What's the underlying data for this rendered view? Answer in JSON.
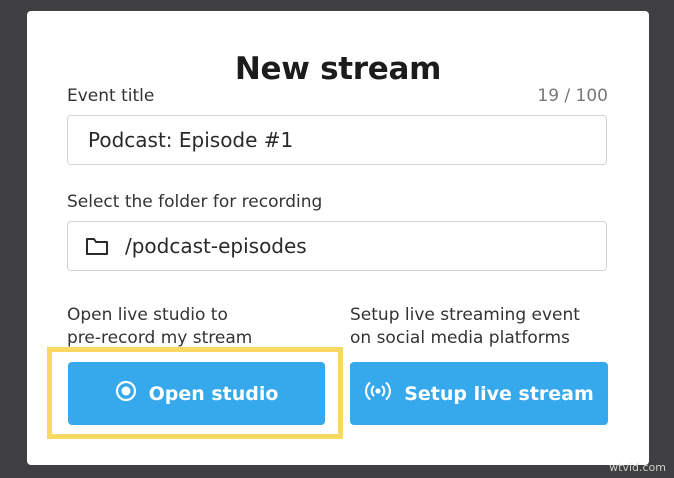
{
  "dialog": {
    "title": "New stream",
    "event_title_label": "Event title",
    "event_title_counter": "19 / 100",
    "event_title_value": "Podcast: Episode #1",
    "folder_label": "Select the folder for recording",
    "folder_value": "/podcast-episodes",
    "folder_icon": "folder-icon"
  },
  "options": {
    "studio": {
      "description_line1": "Open live studio to",
      "description_line2": "pre-record my stream",
      "button_label": "Open studio",
      "button_icon": "record-icon"
    },
    "live": {
      "description_line1": "Setup live streaming event",
      "description_line2": "on social media platforms",
      "button_label": "Setup live stream",
      "button_icon": "broadcast-icon"
    }
  },
  "colors": {
    "button_bg": "#35a9ec",
    "highlight": "#fad962",
    "backdrop": "#3f3f42"
  },
  "watermark": "wtvid.com"
}
